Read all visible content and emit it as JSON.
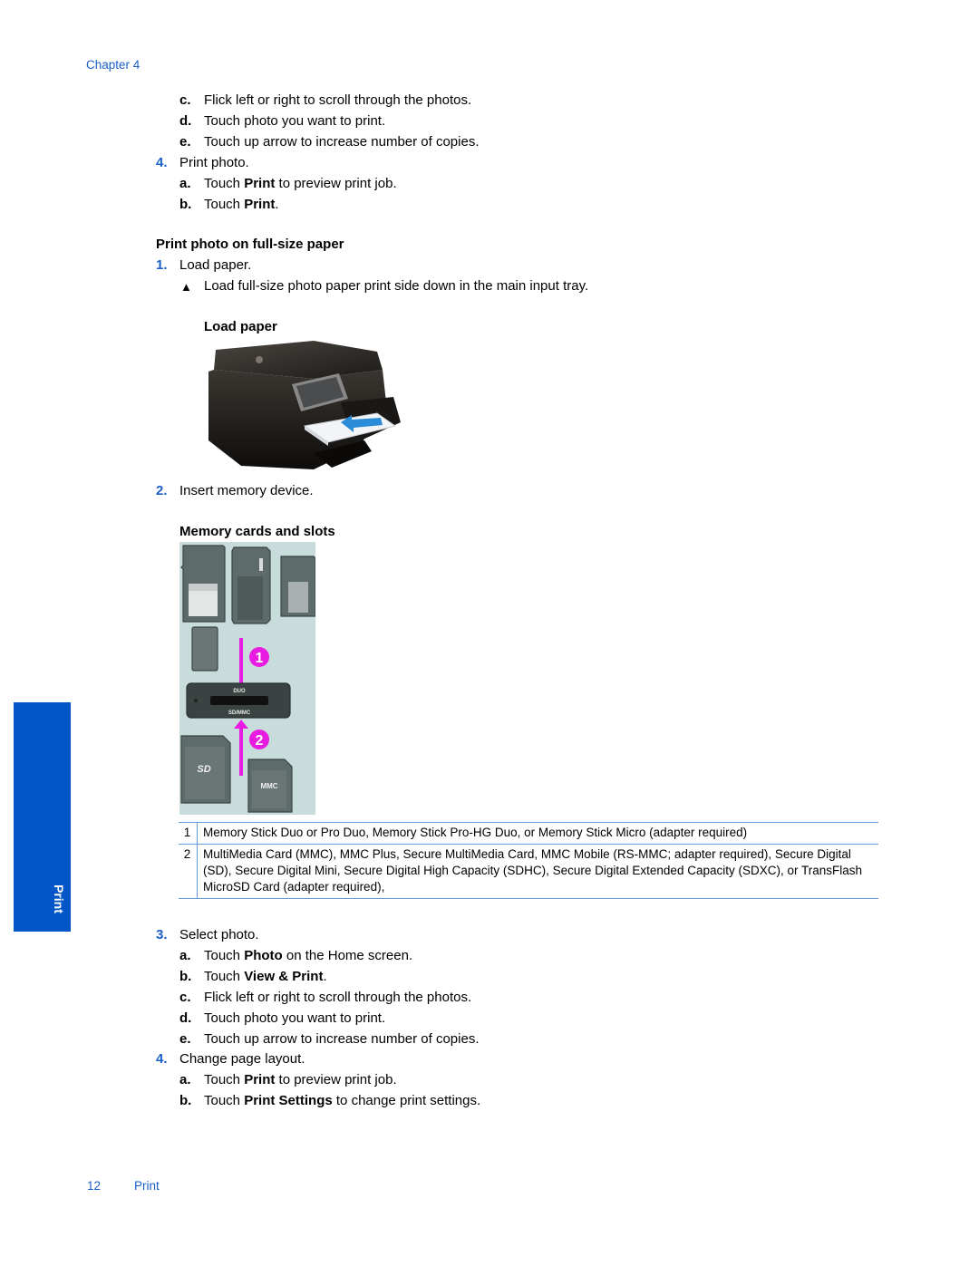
{
  "header": {
    "chapter": "Chapter 4"
  },
  "section_top": {
    "steps": [
      {
        "marker": "c",
        "text": "Flick left or right to scroll through the photos."
      },
      {
        "marker": "d",
        "text": "Touch photo you want to print."
      },
      {
        "marker": "e",
        "text": "Touch up arrow to increase number of copies."
      }
    ],
    "step4": {
      "number": "4.",
      "text": "Print photo.",
      "substeps": [
        {
          "marker": "a",
          "pre": "Touch ",
          "bold": "Print",
          "post": " to preview print job."
        },
        {
          "marker": "b",
          "pre": "Touch ",
          "bold": "Print",
          "post": "."
        }
      ]
    }
  },
  "full_size": {
    "heading": "Print photo on full-size paper",
    "step1": {
      "number": "1.",
      "text": "Load paper."
    },
    "bullet": {
      "icon": "triangle-bullet-icon",
      "glyph": "▲",
      "text": "Load full-size photo paper print side down in the main input tray."
    },
    "figure1": {
      "caption": "Load paper",
      "alt": "Printer with paper loaded into the main input tray"
    },
    "step2": {
      "number": "2.",
      "text": "Insert memory device."
    },
    "figure2": {
      "caption": "Memory cards and slots",
      "callouts": [
        "1",
        "2"
      ],
      "labels": {
        "slot_top": "DUO",
        "slot_bottom": "SD/MMC",
        "card_sd": "SD",
        "card_mmc": "MMC"
      }
    },
    "table": [
      {
        "index": "1",
        "text": "Memory Stick Duo or Pro Duo, Memory Stick Pro-HG Duo, or Memory Stick Micro (adapter required)"
      },
      {
        "index": "2",
        "text": "MultiMedia Card (MMC), MMC Plus, Secure MultiMedia Card, MMC Mobile (RS-MMC; adapter required), Secure Digital (SD), Secure Digital Mini, Secure Digital High Capacity (SDHC), Secure Digital Extended Capacity (SDXC), or TransFlash MicroSD Card (adapter required),"
      }
    ],
    "step3": {
      "number": "3.",
      "text": "Select photo.",
      "substeps": [
        {
          "marker": "a",
          "pre": "Touch ",
          "bold": "Photo",
          "post": " on the Home screen."
        },
        {
          "marker": "b",
          "pre": "Touch ",
          "bold": "View & Print",
          "post": "."
        },
        {
          "marker": "c",
          "pre": "Flick left or right to scroll through the photos.",
          "bold": "",
          "post": ""
        },
        {
          "marker": "d",
          "pre": "Touch photo you want to print.",
          "bold": "",
          "post": ""
        },
        {
          "marker": "e",
          "pre": "Touch up arrow to increase number of copies.",
          "bold": "",
          "post": ""
        }
      ]
    },
    "step4": {
      "number": "4.",
      "text": "Change page layout.",
      "substeps": [
        {
          "marker": "a",
          "pre": "Touch ",
          "bold": "Print",
          "post": " to preview print job."
        },
        {
          "marker": "b",
          "pre": "Touch ",
          "bold": "Print Settings",
          "post": " to change print settings."
        }
      ]
    }
  },
  "side_tab": {
    "label": "Print",
    "color": "#0256c7"
  },
  "footer": {
    "page_number": "12",
    "section": "Print"
  },
  "colors": {
    "accent": "#1a5fc8",
    "rule": "#5e9bd8",
    "callout": "#e81ce0"
  }
}
